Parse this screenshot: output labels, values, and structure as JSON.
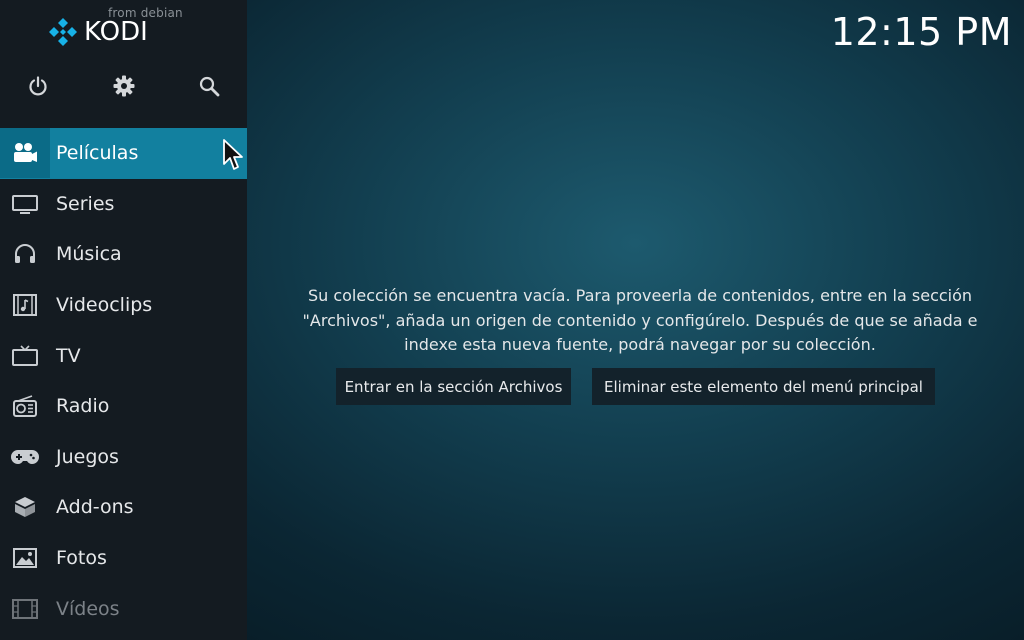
{
  "brand": {
    "name": "KODI",
    "sub": "from debian",
    "accent": "#12809f"
  },
  "clock": "12:15 PM",
  "top_icons": [
    "power-icon",
    "gear-icon",
    "search-icon"
  ],
  "menu": {
    "items": [
      {
        "label": "Películas",
        "icon": "movie-camera-icon",
        "active": true
      },
      {
        "label": "Series",
        "icon": "monitor-icon"
      },
      {
        "label": "Música",
        "icon": "headphones-icon"
      },
      {
        "label": "Videoclips",
        "icon": "music-video-icon"
      },
      {
        "label": "TV",
        "icon": "tv-icon"
      },
      {
        "label": "Radio",
        "icon": "radio-icon"
      },
      {
        "label": "Juegos",
        "icon": "gamepad-icon"
      },
      {
        "label": "Add-ons",
        "icon": "box-icon"
      },
      {
        "label": "Fotos",
        "icon": "picture-icon"
      },
      {
        "label": "Vídeos",
        "icon": "film-strip-icon"
      }
    ]
  },
  "content": {
    "message_line1": "Su colección se encuentra vacía. Para proveerla de contenidos, entre en la sección",
    "message_line2": "\"Archivos\", añada un origen de contenido y configúrelo. Después de que se añada e",
    "message_line3": "indexe esta nueva fuente, podrá navegar por su colección.",
    "button_files": "Entrar en la sección Archivos",
    "button_remove": "Eliminar este elemento del menú principal"
  }
}
